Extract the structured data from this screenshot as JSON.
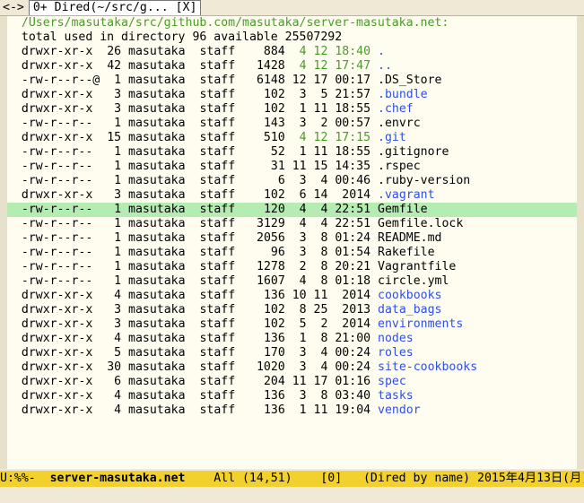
{
  "tabbar": {
    "nav_label": "<->",
    "tab_label": "0+ Dired(~/src/g... [X]"
  },
  "dired": {
    "path_header": "/Users/masutaka/src/github.com/masutaka/server-masutaka.net:",
    "total_line": "total used in directory 96 available 25507292",
    "entries": [
      {
        "perms": "drwxr-xr-x",
        "links": "26",
        "owner": "masutaka",
        "group": "staff",
        "size": "884",
        "date": "4 12 18:40",
        "name": ".",
        "type": "dir",
        "date_green": true
      },
      {
        "perms": "drwxr-xr-x",
        "links": "42",
        "owner": "masutaka",
        "group": "staff",
        "size": "1428",
        "date": "4 12 17:47",
        "name": "..",
        "type": "dir",
        "date_green": true
      },
      {
        "perms": "-rw-r--r--@",
        "links": "1",
        "owner": "masutaka",
        "group": "staff",
        "size": "6148",
        "date": "12 17 00:17",
        "name": ".DS_Store",
        "type": "file",
        "date_green": false
      },
      {
        "perms": "drwxr-xr-x",
        "links": "3",
        "owner": "masutaka",
        "group": "staff",
        "size": "102",
        "date": "3  5 21:57",
        "name": ".bundle",
        "type": "dir",
        "date_green": false
      },
      {
        "perms": "drwxr-xr-x",
        "links": "3",
        "owner": "masutaka",
        "group": "staff",
        "size": "102",
        "date": "1 11 18:55",
        "name": ".chef",
        "type": "dir",
        "date_green": false
      },
      {
        "perms": "-rw-r--r--",
        "links": "1",
        "owner": "masutaka",
        "group": "staff",
        "size": "143",
        "date": "3  2 00:57",
        "name": ".envrc",
        "type": "file",
        "date_green": false
      },
      {
        "perms": "drwxr-xr-x",
        "links": "15",
        "owner": "masutaka",
        "group": "staff",
        "size": "510",
        "date": "4 12 17:15",
        "name": ".git",
        "type": "dir",
        "date_green": true
      },
      {
        "perms": "-rw-r--r--",
        "links": "1",
        "owner": "masutaka",
        "group": "staff",
        "size": "52",
        "date": "1 11 18:55",
        "name": ".gitignore",
        "type": "file",
        "date_green": false
      },
      {
        "perms": "-rw-r--r--",
        "links": "1",
        "owner": "masutaka",
        "group": "staff",
        "size": "31",
        "date": "11 15 14:35",
        "name": ".rspec",
        "type": "file",
        "date_green": false
      },
      {
        "perms": "-rw-r--r--",
        "links": "1",
        "owner": "masutaka",
        "group": "staff",
        "size": "6",
        "date": "3  4 00:46",
        "name": ".ruby-version",
        "type": "file",
        "date_green": false
      },
      {
        "perms": "drwxr-xr-x",
        "links": "3",
        "owner": "masutaka",
        "group": "staff",
        "size": "102",
        "date": "6 14  2014",
        "name": ".vagrant",
        "type": "dir",
        "date_green": false
      },
      {
        "perms": "-rw-r--r--",
        "links": "1",
        "owner": "masutaka",
        "group": "staff",
        "size": "120",
        "date": "4  4 22:51",
        "name": "Gemfile",
        "type": "file",
        "date_green": false,
        "selected": true
      },
      {
        "perms": "-rw-r--r--",
        "links": "1",
        "owner": "masutaka",
        "group": "staff",
        "size": "3129",
        "date": "4  4 22:51",
        "name": "Gemfile.lock",
        "type": "file",
        "date_green": false
      },
      {
        "perms": "-rw-r--r--",
        "links": "1",
        "owner": "masutaka",
        "group": "staff",
        "size": "2056",
        "date": "3  8 01:24",
        "name": "README.md",
        "type": "file",
        "date_green": false
      },
      {
        "perms": "-rw-r--r--",
        "links": "1",
        "owner": "masutaka",
        "group": "staff",
        "size": "96",
        "date": "3  8 01:54",
        "name": "Rakefile",
        "type": "file",
        "date_green": false
      },
      {
        "perms": "-rw-r--r--",
        "links": "1",
        "owner": "masutaka",
        "group": "staff",
        "size": "1278",
        "date": "2  8 20:21",
        "name": "Vagrantfile",
        "type": "file",
        "date_green": false
      },
      {
        "perms": "-rw-r--r--",
        "links": "1",
        "owner": "masutaka",
        "group": "staff",
        "size": "1607",
        "date": "4  8 01:18",
        "name": "circle.yml",
        "type": "file",
        "date_green": false
      },
      {
        "perms": "drwxr-xr-x",
        "links": "4",
        "owner": "masutaka",
        "group": "staff",
        "size": "136",
        "date": "10 11  2014",
        "name": "cookbooks",
        "type": "dir",
        "date_green": false
      },
      {
        "perms": "drwxr-xr-x",
        "links": "3",
        "owner": "masutaka",
        "group": "staff",
        "size": "102",
        "date": "8 25  2013",
        "name": "data_bags",
        "type": "dir",
        "date_green": false
      },
      {
        "perms": "drwxr-xr-x",
        "links": "3",
        "owner": "masutaka",
        "group": "staff",
        "size": "102",
        "date": "5  2  2014",
        "name": "environments",
        "type": "dir",
        "date_green": false
      },
      {
        "perms": "drwxr-xr-x",
        "links": "4",
        "owner": "masutaka",
        "group": "staff",
        "size": "136",
        "date": "1  8 21:00",
        "name": "nodes",
        "type": "dir",
        "date_green": false
      },
      {
        "perms": "drwxr-xr-x",
        "links": "5",
        "owner": "masutaka",
        "group": "staff",
        "size": "170",
        "date": "3  4 00:24",
        "name": "roles",
        "type": "dir",
        "date_green": false
      },
      {
        "perms": "drwxr-xr-x",
        "links": "30",
        "owner": "masutaka",
        "group": "staff",
        "size": "1020",
        "date": "3  4 00:24",
        "name": "site-cookbooks",
        "type": "dir",
        "date_green": false
      },
      {
        "perms": "drwxr-xr-x",
        "links": "6",
        "owner": "masutaka",
        "group": "staff",
        "size": "204",
        "date": "11 17 01:16",
        "name": "spec",
        "type": "dir",
        "date_green": false
      },
      {
        "perms": "drwxr-xr-x",
        "links": "4",
        "owner": "masutaka",
        "group": "staff",
        "size": "136",
        "date": "3  8 03:40",
        "name": "tasks",
        "type": "dir",
        "date_green": false
      },
      {
        "perms": "drwxr-xr-x",
        "links": "4",
        "owner": "masutaka",
        "group": "staff",
        "size": "136",
        "date": "1 11 19:04",
        "name": "vendor",
        "type": "dir",
        "date_green": false
      }
    ]
  },
  "modeline": {
    "status": "U:%%-",
    "buffer_name": "server-masutaka.net",
    "position": "All (14,51)",
    "depth": "[0]",
    "mode": "(Dired by name)",
    "date": "2015年4月13日(月)"
  },
  "colors": {
    "header_green": "#4a9a2a",
    "dir_blue": "#2f4fe0",
    "highlight": "#b5ecb2",
    "modeline_yellow": "#f2d12e"
  }
}
